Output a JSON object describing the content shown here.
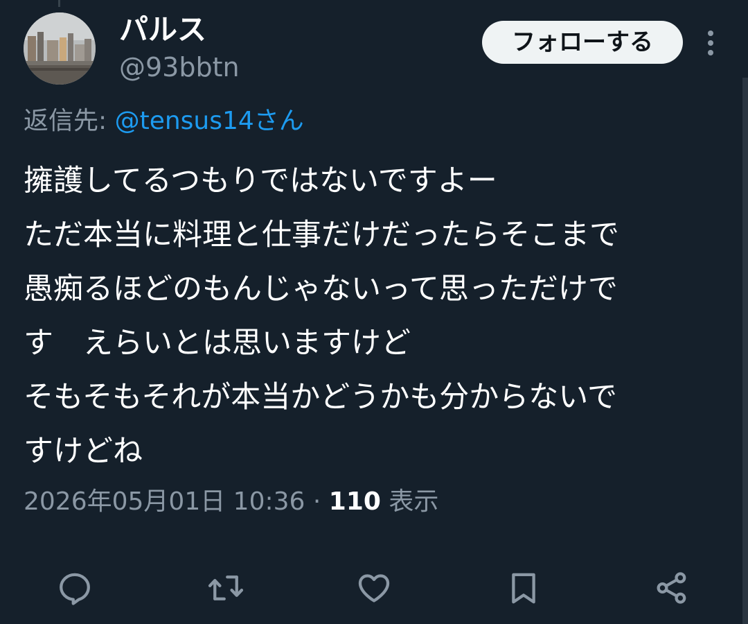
{
  "user": {
    "name": "パルス",
    "handle": "@93bbtn",
    "avatar_icon": "profile-photo-cityscape"
  },
  "follow_button": {
    "label": "フォローする"
  },
  "more_icon": "more-vertical-icon",
  "reply_to": {
    "prefix": "返信先: ",
    "mention": "@tensus14",
    "suffix": "さん"
  },
  "tweet": {
    "lines": [
      "擁護してるつもりではないですよー",
      "ただ本当に料理と仕事だけだったらそこまで",
      "愚痴るほどのもんじゃないって思っただけで",
      "す　えらいとは思いますけど",
      "そもそもそれが本当かどうかも分からないで",
      "すけどね"
    ]
  },
  "meta": {
    "timestamp": "2026年05月01日 10:36",
    "separator": " · ",
    "views": "110",
    "views_label": " 表示"
  },
  "actions": [
    {
      "name": "reply",
      "icon": "reply-icon"
    },
    {
      "name": "retweet",
      "icon": "retweet-icon"
    },
    {
      "name": "like",
      "icon": "heart-icon"
    },
    {
      "name": "bookmark",
      "icon": "bookmark-icon"
    },
    {
      "name": "share",
      "icon": "share-icon"
    }
  ],
  "colors": {
    "background": "#15202b",
    "secondary_text": "#8b98a5",
    "link": "#1d9bf0",
    "button_bg": "#eff3f4"
  }
}
